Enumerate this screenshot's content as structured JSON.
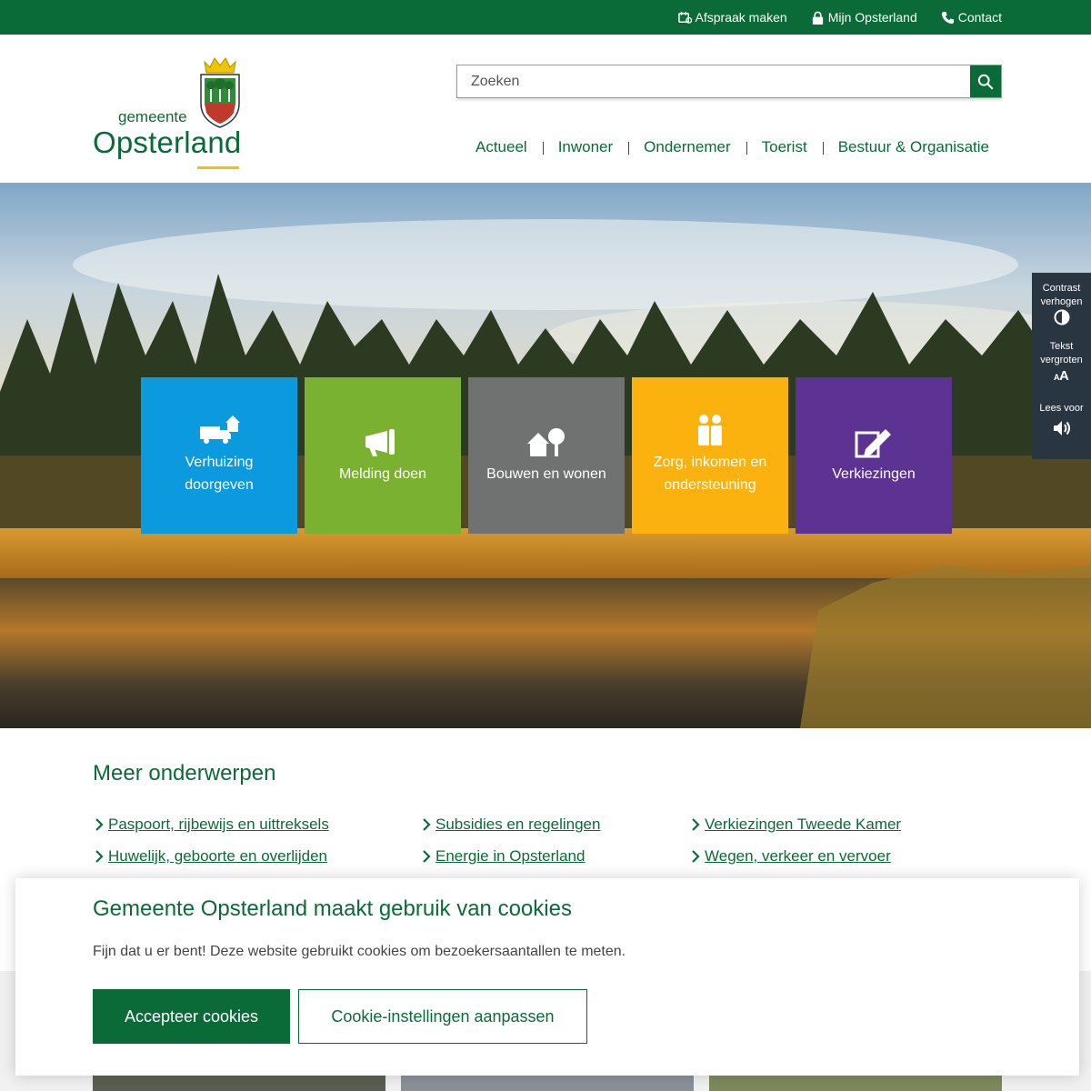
{
  "topbar": {
    "links": [
      {
        "label": "Afspraak maken",
        "icon": "calendar-icon"
      },
      {
        "label": "Mijn Opsterland",
        "icon": "lock-icon"
      },
      {
        "label": "Contact",
        "icon": "phone-icon"
      }
    ]
  },
  "logo": {
    "small": "gemeente",
    "big": "Opsterland"
  },
  "search": {
    "placeholder": "Zoeken"
  },
  "nav": [
    "Actueel",
    "Inwoner",
    "Ondernemer",
    "Toerist",
    "Bestuur & Organisatie"
  ],
  "tiles": [
    {
      "label": "Verhuizing doorgeven",
      "icon": "moving-truck-icon",
      "color": "#0c9ade"
    },
    {
      "label": "Melding doen",
      "icon": "megaphone-icon",
      "color": "#7ab130"
    },
    {
      "label": "Bouwen en wonen",
      "icon": "house-tree-icon",
      "color": "#6f7271"
    },
    {
      "label": "Zorg, inkomen en ondersteuning",
      "icon": "people-icon",
      "color": "#fbb20f"
    },
    {
      "label": "Verkiezingen",
      "icon": "pencil-ballot-icon",
      "color": "#5c3393"
    }
  ],
  "a11y": {
    "contrast": "Contrast verhogen",
    "text": "Tekst vergroten",
    "read": "Lees voor"
  },
  "meer": {
    "title": "Meer onderwerpen",
    "links": [
      "Paspoort, rijbewijs en uittreksels",
      "Subsidies en regelingen",
      "Verkiezingen Tweede Kamer",
      "Huwelijk, geboorte en overlijden",
      "Energie in Opsterland",
      "Wegen, verkeer en vervoer"
    ]
  },
  "cookie": {
    "title": "Gemeente Opsterland maakt gebruik van cookies",
    "text": "Fijn dat u er bent! Deze website gebruikt cookies om bezoekersaantallen te meten.",
    "accept": "Accepteer cookies",
    "settings": "Cookie-instellingen aanpassen"
  },
  "colors": {
    "brand": "#0b6b38",
    "accent": "#f0c400"
  }
}
